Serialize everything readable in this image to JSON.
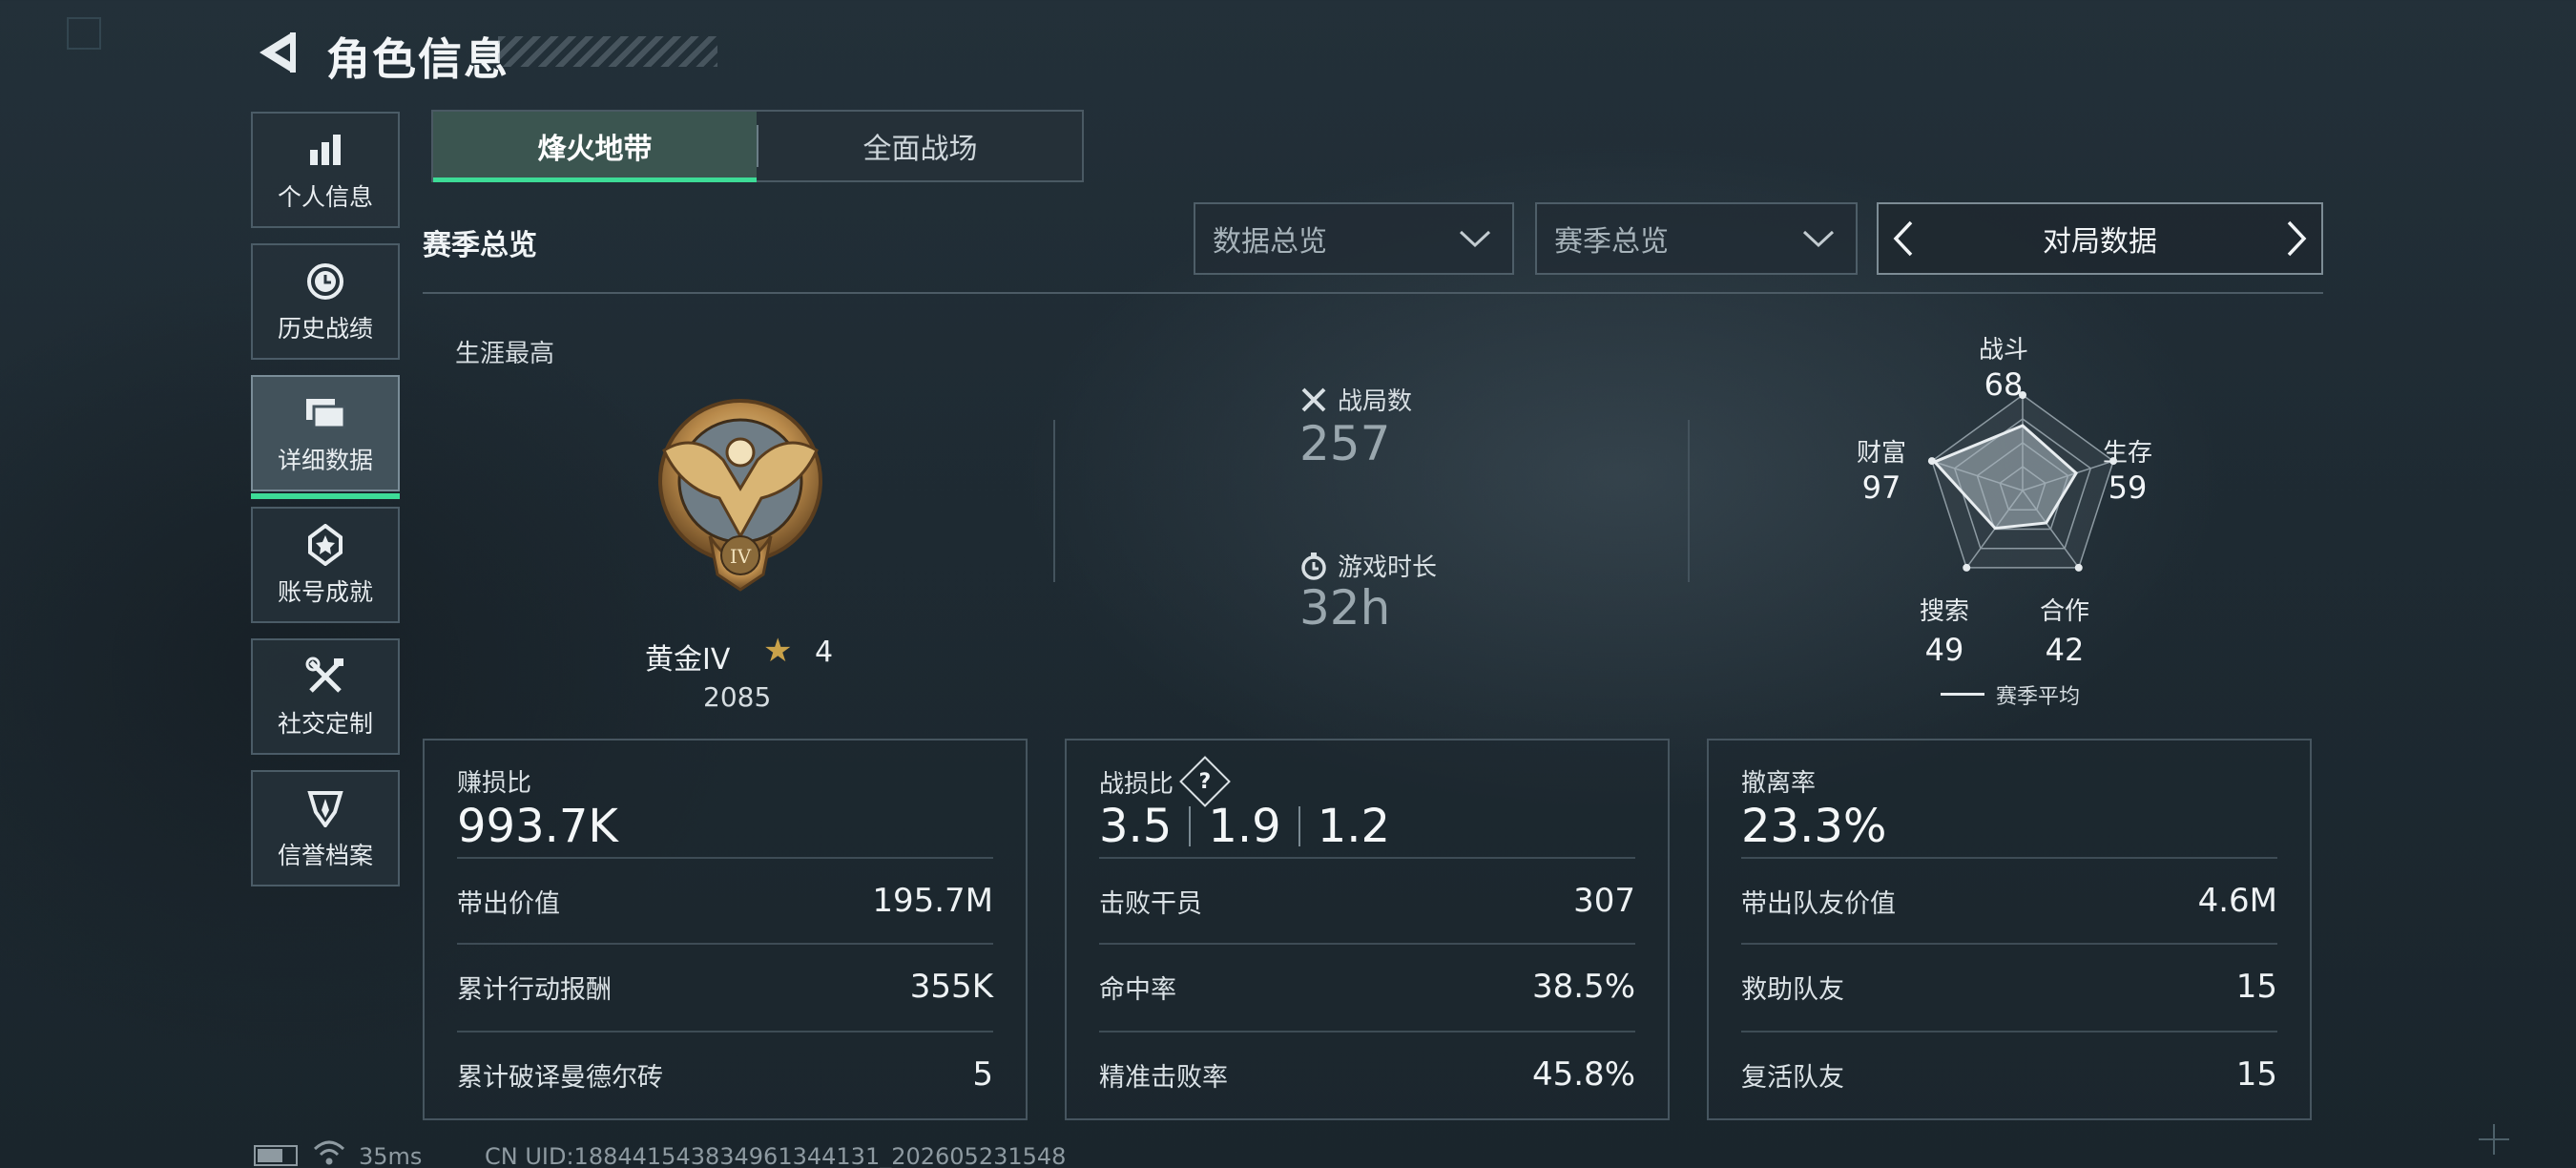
{
  "header": {
    "title": "角色信息",
    "back_icon": "back-arrow-icon"
  },
  "sidebar": {
    "items": [
      {
        "label": "个人信息",
        "icon": "bar-chart-icon",
        "active": false
      },
      {
        "label": "历史战绩",
        "icon": "history-clock-icon",
        "active": false
      },
      {
        "label": "详细数据",
        "icon": "stacked-cards-icon",
        "active": true
      },
      {
        "label": "账号成就",
        "icon": "achievement-badge-icon",
        "active": false
      },
      {
        "label": "社交定制",
        "icon": "wrench-tools-icon",
        "active": false
      },
      {
        "label": "信誉档案",
        "icon": "reputation-shield-icon",
        "active": false
      }
    ]
  },
  "tabs": [
    {
      "label": "烽火地带",
      "active": true
    },
    {
      "label": "全面战场",
      "active": false
    }
  ],
  "section_title": "赛季总览",
  "filters": {
    "data_dropdown": "数据总览",
    "season_dropdown": "赛季总览",
    "pager_label": "对局数据"
  },
  "overview": {
    "career_label": "生涯最高",
    "rank": {
      "name": "黄金IV",
      "stars": "4",
      "score": "2085",
      "medal_numeral": "IV"
    },
    "matches": {
      "label": "战局数",
      "value": "257"
    },
    "playtime": {
      "label": "游戏时长",
      "value": "32h"
    }
  },
  "radar": {
    "axes": [
      {
        "label": "战斗",
        "value": 68
      },
      {
        "label": "生存",
        "value": 59
      },
      {
        "label": "合作",
        "value": 42
      },
      {
        "label": "搜索",
        "value": 49
      },
      {
        "label": "财富",
        "value": 97
      }
    ],
    "legend": "赛季平均"
  },
  "cards": {
    "profit": {
      "title": "赚损比",
      "main": "993.7K",
      "rows": [
        {
          "label": "带出价值",
          "value": "195.7M"
        },
        {
          "label": "累计行动报酬",
          "value": "355K"
        },
        {
          "label": "累计破译曼德尔砖",
          "value": "5"
        }
      ]
    },
    "combat": {
      "title": "战损比",
      "help": "?",
      "kd": [
        "3.5",
        "1.9",
        "1.2"
      ],
      "rows": [
        {
          "label": "击败干员",
          "value": "307"
        },
        {
          "label": "命中率",
          "value": "38.5%"
        },
        {
          "label": "精准击败率",
          "value": "45.8%"
        }
      ]
    },
    "extract": {
      "title": "撤离率",
      "main": "23.3%",
      "rows": [
        {
          "label": "带出队友价值",
          "value": "4.6M"
        },
        {
          "label": "救助队友",
          "value": "15"
        },
        {
          "label": "复活队友",
          "value": "15"
        }
      ]
    }
  },
  "footer": {
    "ping": "35ms",
    "uid": "CN UID:1884415438349613441​31_202605231548"
  },
  "colors": {
    "accent": "#3ddc97",
    "medal_gold": "#c9a24a"
  }
}
